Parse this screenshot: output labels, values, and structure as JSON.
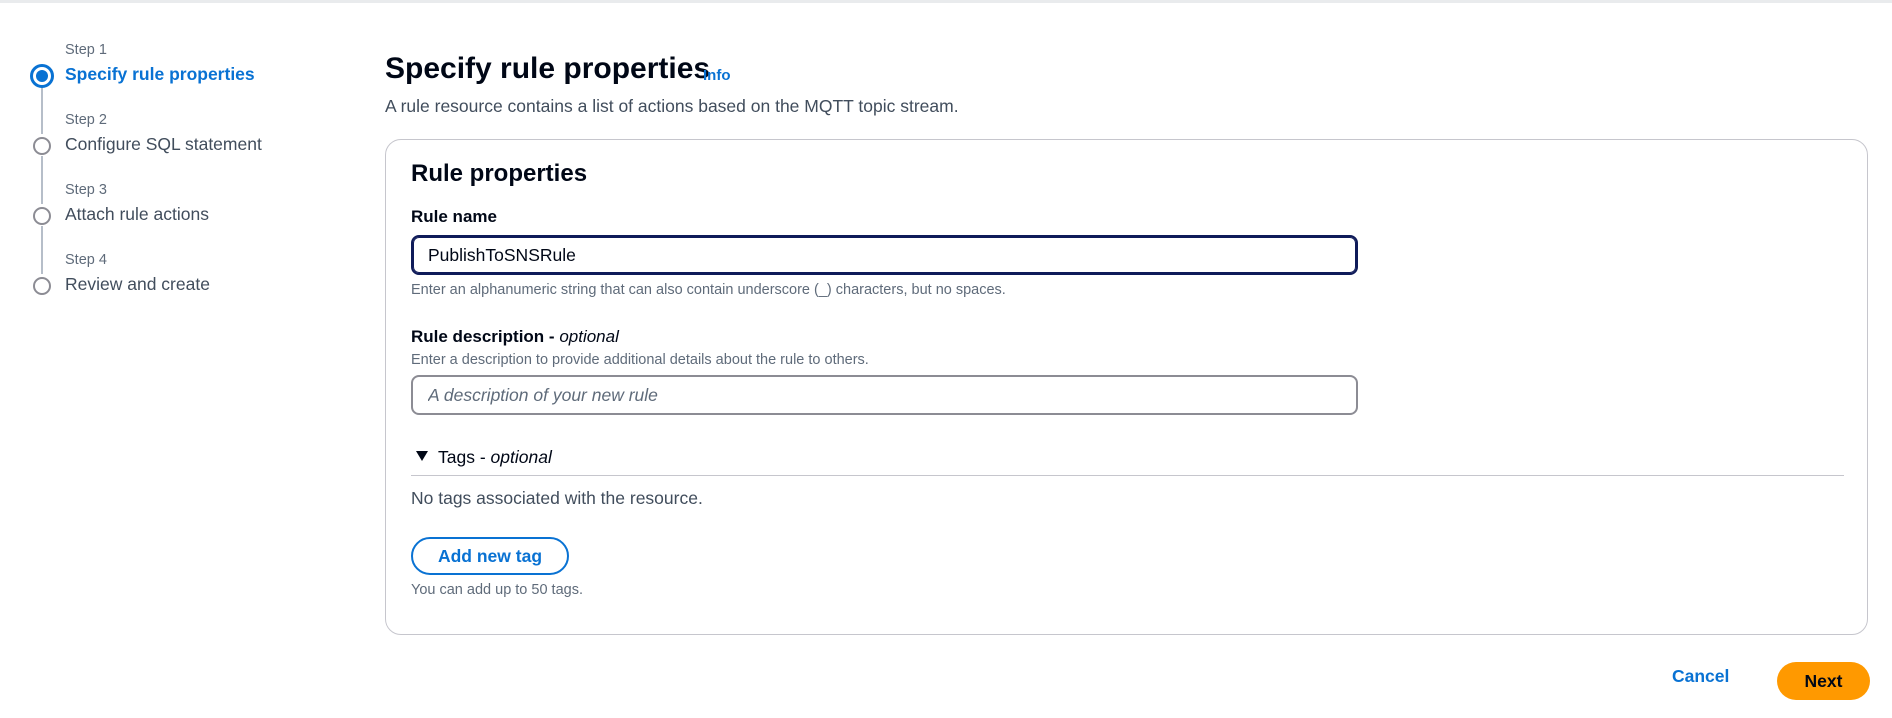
{
  "wizard": {
    "steps": [
      {
        "number": "Step 1",
        "title": "Specify rule properties",
        "state": "active"
      },
      {
        "number": "Step 2",
        "title": "Configure SQL statement",
        "state": "pending"
      },
      {
        "number": "Step 3",
        "title": "Attach rule actions",
        "state": "pending"
      },
      {
        "number": "Step 4",
        "title": "Review and create",
        "state": "pending"
      }
    ]
  },
  "header": {
    "title": "Specify rule properties",
    "info_link": "Info",
    "description": "A rule resource contains a list of actions based on the MQTT topic stream."
  },
  "panel": {
    "title": "Rule properties",
    "rule_name": {
      "label": "Rule name",
      "value": "PublishToSNSRule",
      "constraint": "Enter an alphanumeric string that can also contain underscore (_) characters, but no spaces."
    },
    "rule_description": {
      "label": "Rule description -",
      "optional": "optional",
      "hint": "Enter a description to provide additional details about the rule to others.",
      "value": "",
      "placeholder": "A description of your new rule"
    },
    "tags": {
      "label": "Tags -",
      "optional": "optional",
      "expanded": true,
      "empty_text": "No tags associated with the resource.",
      "add_button": "Add new tag",
      "limit_text": "You can add up to 50 tags."
    }
  },
  "footer": {
    "cancel_label": "Cancel",
    "next_label": "Next"
  },
  "colors": {
    "accent": "#0972d3",
    "primary_button": "#ff9900",
    "text": "#000716",
    "muted": "#5f6b7a"
  }
}
